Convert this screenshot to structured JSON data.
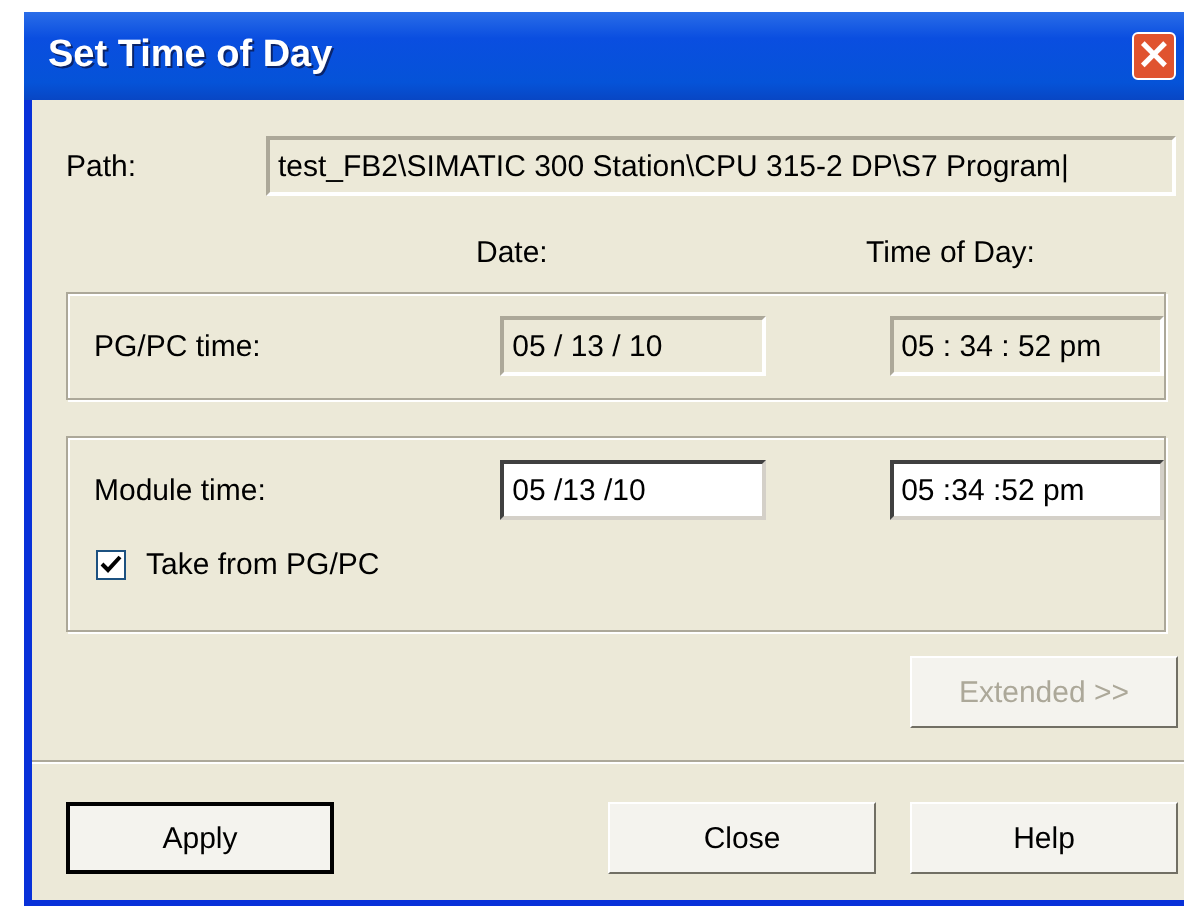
{
  "window": {
    "title": "Set Time of Day",
    "close": "×"
  },
  "path": {
    "label": "Path:",
    "value": "test_FB2\\SIMATIC 300 Station\\CPU 315-2 DP\\S7 Program|"
  },
  "headers": {
    "date": "Date:",
    "time": "Time of Day:"
  },
  "pg_pc": {
    "label": "PG/PC time:",
    "date": "05 / 13 / 10",
    "time": "05 : 34 : 52  pm",
    "disabled": true
  },
  "module": {
    "label": "Module time:",
    "date": "05  /13  /10",
    "time": "05  :34  :52  pm",
    "disabled": false
  },
  "take_from_pg": {
    "label": "Take from PG/PC",
    "checked": true
  },
  "extended_button": {
    "label": "Extended >>",
    "disabled": true
  },
  "buttons": [
    {
      "label": "Apply",
      "default": true
    },
    {
      "label": "Close",
      "default": false
    },
    {
      "label": "Help",
      "default": false
    }
  ]
}
